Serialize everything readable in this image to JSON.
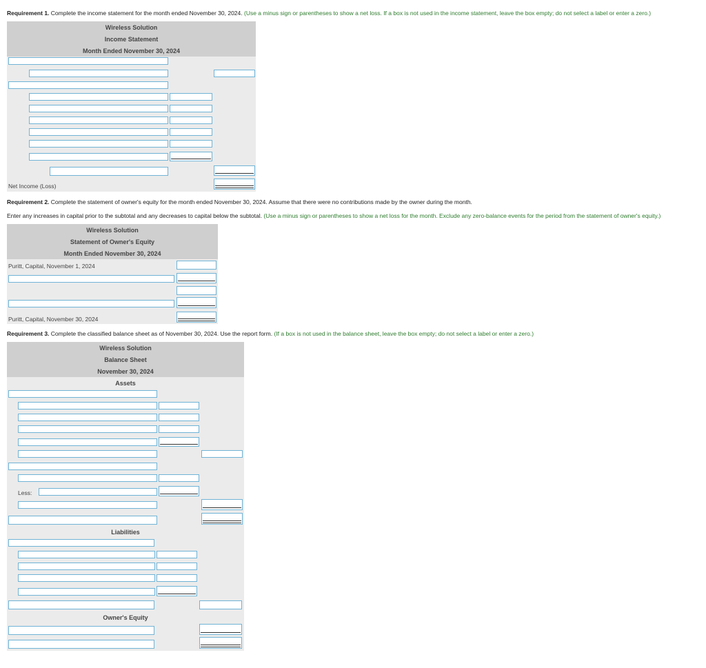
{
  "req1": {
    "title": "Requirement 1.",
    "text": "Complete the income statement for the month ended November 30, 2024.",
    "hint": "(Use a minus sign or parentheses to show a net loss. If a box is not used in the income statement, leave the box empty; do not select a label or enter a zero.)"
  },
  "income_statement": {
    "company": "Wireless Solution",
    "statement": "Income Statement",
    "period": "Month Ended November 30, 2024",
    "net_income_label": "Net Income (Loss)"
  },
  "req2": {
    "title": "Requirement 2.",
    "text": "Complete the statement of owner's equity for the month ended November 30, 2024. Assume that there were no contributions made by the owner during the month.",
    "text2": "Enter any increases in capital prior to the subtotal and any decreases to capital below the subtotal.",
    "hint": "(Use a minus sign or parentheses to show a net loss for the month. Exclude any zero-balance events for the period from the statement of owner's equity.)"
  },
  "owners_equity": {
    "company": "Wireless Solution",
    "statement": "Statement of Owner's Equity",
    "period": "Month Ended November 30, 2024",
    "begin_label": "Puritt, Capital, November 1, 2024",
    "end_label": "Puritt, Capital, November 30, 2024"
  },
  "req3": {
    "title": "Requirement 3.",
    "text": "Complete the classified balance sheet as of November 30, 2024. Use the report form.",
    "hint": "(If a box is not used in the balance sheet, leave the box empty; do not select a label or enter a zero.)"
  },
  "balance_sheet": {
    "company": "Wireless Solution",
    "statement": "Balance Sheet",
    "date": "November 30, 2024",
    "assets": "Assets",
    "less_label": "Less:",
    "liabilities": "Liabilities",
    "owners_equity": "Owner's Equity"
  }
}
